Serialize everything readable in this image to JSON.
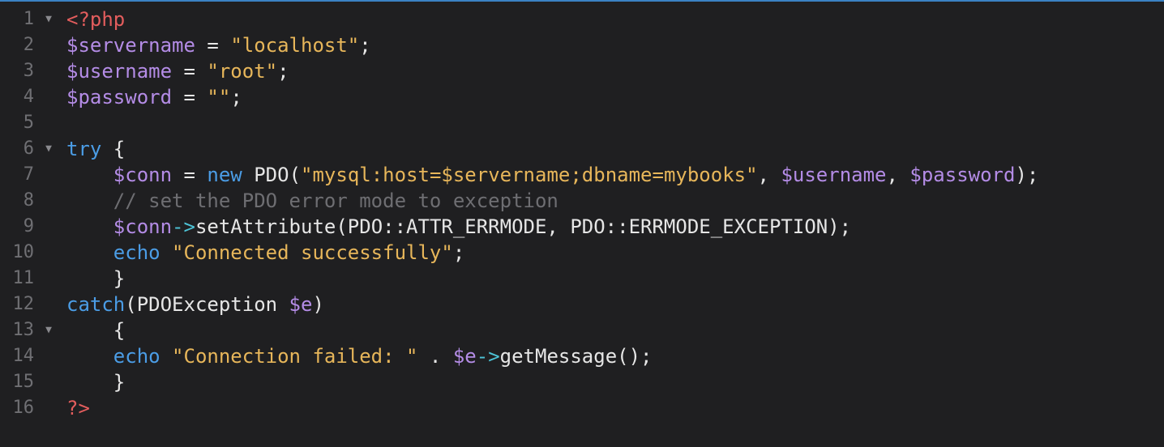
{
  "colors": {
    "background": "#1f1f21",
    "line_number": "#6f6f73",
    "php_tag": "#e35d5d",
    "variable": "#b48ce6",
    "string": "#e7b65a",
    "keyword": "#4b9de6",
    "comment": "#6e6e72",
    "operator_arrow": "#4dc3d6",
    "default_text": "#e6e6e6",
    "top_border_accent": "#3b82c4"
  },
  "fold_icon": "triangle-down-icon",
  "lines": [
    {
      "num": "1",
      "fold": "▼",
      "tokens": [
        {
          "t": "tag",
          "s": "<?php"
        }
      ]
    },
    {
      "num": "2",
      "fold": "",
      "tokens": [
        {
          "t": "var",
          "s": "$servername"
        },
        {
          "t": "plain",
          "s": " = "
        },
        {
          "t": "str",
          "s": "\"localhost\""
        },
        {
          "t": "plain",
          "s": ";"
        }
      ]
    },
    {
      "num": "3",
      "fold": "",
      "tokens": [
        {
          "t": "var",
          "s": "$username"
        },
        {
          "t": "plain",
          "s": " = "
        },
        {
          "t": "str",
          "s": "\"root\""
        },
        {
          "t": "plain",
          "s": ";"
        }
      ]
    },
    {
      "num": "4",
      "fold": "",
      "tokens": [
        {
          "t": "var",
          "s": "$password"
        },
        {
          "t": "plain",
          "s": " = "
        },
        {
          "t": "str",
          "s": "\"\""
        },
        {
          "t": "plain",
          "s": ";"
        }
      ]
    },
    {
      "num": "5",
      "fold": "",
      "tokens": []
    },
    {
      "num": "6",
      "fold": "▼",
      "tokens": [
        {
          "t": "kw",
          "s": "try"
        },
        {
          "t": "plain",
          "s": " {"
        }
      ]
    },
    {
      "num": "7",
      "fold": "",
      "tokens": [
        {
          "t": "plain",
          "s": "    "
        },
        {
          "t": "var",
          "s": "$conn"
        },
        {
          "t": "plain",
          "s": " = "
        },
        {
          "t": "kw",
          "s": "new"
        },
        {
          "t": "plain",
          "s": " PDO("
        },
        {
          "t": "str",
          "s": "\"mysql:host=$servername;dbname=mybooks\""
        },
        {
          "t": "plain",
          "s": ", "
        },
        {
          "t": "var",
          "s": "$username"
        },
        {
          "t": "plain",
          "s": ", "
        },
        {
          "t": "var",
          "s": "$password"
        },
        {
          "t": "plain",
          "s": ");"
        }
      ]
    },
    {
      "num": "8",
      "fold": "",
      "tokens": [
        {
          "t": "plain",
          "s": "    "
        },
        {
          "t": "cmt",
          "s": "// set the PDO error mode to exception"
        }
      ]
    },
    {
      "num": "9",
      "fold": "",
      "tokens": [
        {
          "t": "plain",
          "s": "    "
        },
        {
          "t": "var",
          "s": "$conn"
        },
        {
          "t": "arrow",
          "s": "->"
        },
        {
          "t": "plain",
          "s": "setAttribute(PDO::ATTR_ERRMODE, PDO::ERRMODE_EXCEPTION);"
        }
      ]
    },
    {
      "num": "10",
      "fold": "",
      "tokens": [
        {
          "t": "plain",
          "s": "    "
        },
        {
          "t": "kw",
          "s": "echo"
        },
        {
          "t": "plain",
          "s": " "
        },
        {
          "t": "str",
          "s": "\"Connected successfully\""
        },
        {
          "t": "plain",
          "s": ";"
        }
      ]
    },
    {
      "num": "11",
      "fold": "",
      "tokens": [
        {
          "t": "plain",
          "s": "    }"
        }
      ]
    },
    {
      "num": "12",
      "fold": "",
      "tokens": [
        {
          "t": "kw",
          "s": "catch"
        },
        {
          "t": "plain",
          "s": "(PDOException "
        },
        {
          "t": "var",
          "s": "$e"
        },
        {
          "t": "plain",
          "s": ")"
        }
      ]
    },
    {
      "num": "13",
      "fold": "▼",
      "tokens": [
        {
          "t": "plain",
          "s": "    {"
        }
      ]
    },
    {
      "num": "14",
      "fold": "",
      "tokens": [
        {
          "t": "plain",
          "s": "    "
        },
        {
          "t": "kw",
          "s": "echo"
        },
        {
          "t": "plain",
          "s": " "
        },
        {
          "t": "str",
          "s": "\"Connection failed: \""
        },
        {
          "t": "plain",
          "s": " . "
        },
        {
          "t": "var",
          "s": "$e"
        },
        {
          "t": "arrow",
          "s": "->"
        },
        {
          "t": "plain",
          "s": "getMessage();"
        }
      ]
    },
    {
      "num": "15",
      "fold": "",
      "tokens": [
        {
          "t": "plain",
          "s": "    }"
        }
      ]
    },
    {
      "num": "16",
      "fold": "",
      "tokens": [
        {
          "t": "tag",
          "s": "?>"
        }
      ]
    }
  ]
}
